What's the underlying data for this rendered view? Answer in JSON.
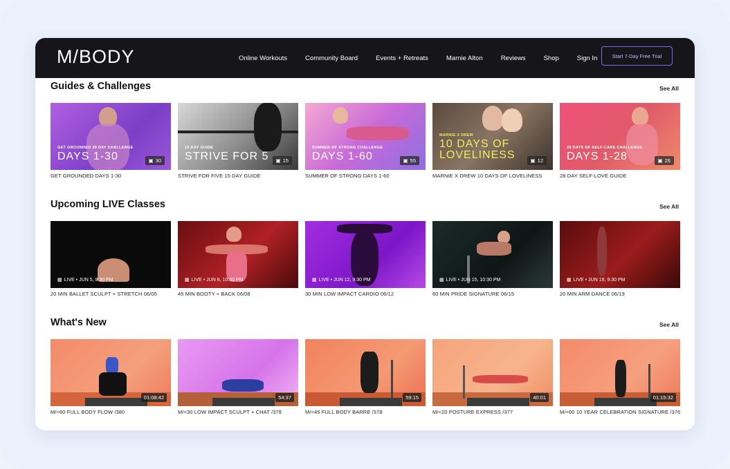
{
  "nav": {
    "logo": "M/BODY",
    "items": [
      "Online Workouts",
      "Community Board",
      "Events + Retreats",
      "Marnie Alton",
      "Reviews",
      "Shop",
      "Sign In"
    ],
    "cta": "Start 7-Day Free Trial"
  },
  "sections": {
    "guides": {
      "title": "Guides & Challenges",
      "see_all": "See All",
      "cards": [
        {
          "small": "GET GROUNDED 30 DAY CHALLENGE",
          "big": "DAYS 1-30",
          "count": "30",
          "caption": "GET GROUNDED DAYS 1-30"
        },
        {
          "small": "15 DAY GUIDE",
          "big": "STRIVE FOR 5",
          "count": "15",
          "caption": "STRIVE FOR FIVE 15 DAY GUIDE"
        },
        {
          "small": "SUMMER OF STRONG CHALLENGE",
          "big": "DAYS 1-60",
          "count": "55",
          "caption": "SUMMER OF STRONG DAYS 1-60"
        },
        {
          "small": "MARNIE X DREW",
          "big": "10 DAYS OF LOVELINESS",
          "count": "12",
          "caption": "MARNIE X DREW 10 DAYS OF LOVELINESS"
        },
        {
          "small": "28 DAYS OF SELF-CARE CHALLENGE",
          "big": "DAYS 1-28",
          "count": "26",
          "caption": "28 DAY SELF-LOVE GUIDE"
        }
      ]
    },
    "live": {
      "title": "Upcoming LIVE Classes",
      "see_all": "See All",
      "cards": [
        {
          "label": "LIVE • JUN 5, 9:30 PM",
          "caption": "20 MIN BALLET SCULPT + STRETCH 06/05"
        },
        {
          "label": "LIVE • JUN 8, 10:30 PM",
          "caption": "45 MIN BOOTY + BACK 06/08"
        },
        {
          "label": "LIVE • JUN 12, 9:30 PM",
          "caption": "30 MIN LOW IMPACT CARDIO 06/12"
        },
        {
          "label": "LIVE • JUN 15, 10:30 PM",
          "caption": "60 MIN PRIDE SIGNATURE 06/15"
        },
        {
          "label": "LIVE • JUN 19, 9:30 PM",
          "caption": "20 MIN ARM DANCE 06/19"
        }
      ]
    },
    "new": {
      "title": "What's New",
      "see_all": "See All",
      "cards": [
        {
          "duration": "01:08:42",
          "caption": "M/<60 FULL BODY FLOW /380"
        },
        {
          "duration": "54:37",
          "caption": "M/<30 LOW IMPACT SCULPT + CHAT /379"
        },
        {
          "duration": "59:15",
          "caption": "M/<45 FULL BODY BARRE /378"
        },
        {
          "duration": "40:01",
          "caption": "M/<20 POSTURE EXPRESS /377"
        },
        {
          "duration": "01:15:32",
          "caption": "M/<60 10 YEAR CELEBRATION SIGNATURE /376"
        }
      ]
    }
  }
}
